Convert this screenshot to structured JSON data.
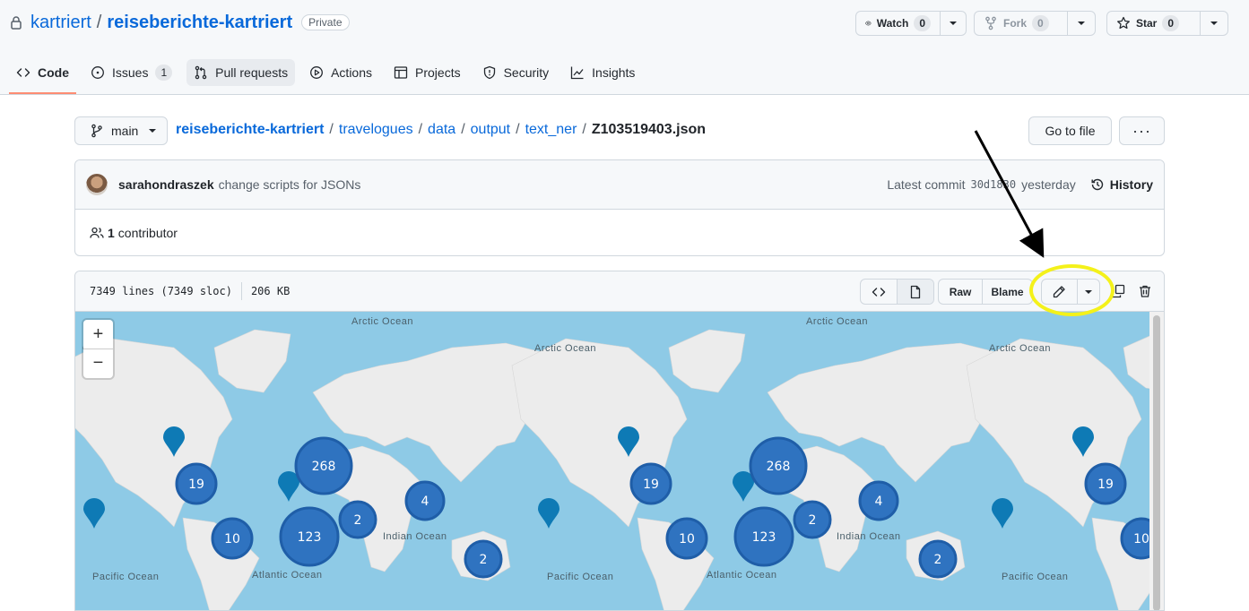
{
  "repo": {
    "owner": "kartriert",
    "separator": "/",
    "name": "reiseberichte-kartriert",
    "visibility": "Private"
  },
  "actions": {
    "watch": {
      "label": "Watch",
      "count": "0"
    },
    "fork": {
      "label": "Fork",
      "count": "0"
    },
    "star": {
      "label": "Star",
      "count": "0"
    }
  },
  "tabs": [
    {
      "label": "Code",
      "icon": "code-icon"
    },
    {
      "label": "Issues",
      "icon": "issue-icon",
      "count": "1"
    },
    {
      "label": "Pull requests",
      "icon": "pull-request-icon"
    },
    {
      "label": "Actions",
      "icon": "play-icon"
    },
    {
      "label": "Projects",
      "icon": "table-icon"
    },
    {
      "label": "Security",
      "icon": "shield-icon"
    },
    {
      "label": "Insights",
      "icon": "graph-icon"
    }
  ],
  "branch": {
    "name": "main"
  },
  "breadcrumb": {
    "root": "reiseberichte-kartriert",
    "parts": [
      "travelogues",
      "data",
      "output",
      "text_ner"
    ],
    "file": "Z103519403.json",
    "sep": "/"
  },
  "buttons": {
    "go_to_file": "Go to file",
    "more": "···"
  },
  "commit": {
    "author": "sarahondraszek",
    "message": "change scripts for JSONs",
    "latest_label": "Latest commit",
    "sha": "30d1830",
    "time": "yesterday",
    "history_label": "History"
  },
  "contributors": {
    "text": "1 contributor",
    "count": "1",
    "label": "contributor"
  },
  "file": {
    "lines": "7349 lines (7349 sloc)",
    "size": "206 KB",
    "raw_label": "Raw",
    "blame_label": "Blame"
  },
  "map": {
    "zoom_in": "+",
    "zoom_out": "−",
    "ocean_labels": [
      "Arctic Ocean",
      "Arctic Ocean",
      "Arctic Ocean",
      "Arctic Ocean",
      "Ocean",
      "Indian Ocean",
      "Indian Ocean",
      "Atlantic Ocean",
      "Atlantic Ocean",
      "Pacific Ocean",
      "Pacific Ocean",
      "Pacific Ocean"
    ],
    "clusters": [
      "268",
      "123",
      "19",
      "10",
      "4",
      "2",
      "2",
      "268",
      "123",
      "19",
      "10",
      "4",
      "2",
      "2",
      "19",
      "10"
    ],
    "marker_color": "#0e7ab5",
    "cluster_color": "#2f73c0",
    "ocean_color": "#8ecae6",
    "land_color": "#ececec"
  },
  "colors": {
    "link": "#0969da",
    "annotation_circle": "#f4f11a",
    "annotation_arrow": "#000000",
    "tab_underline": "#fd8c73"
  }
}
